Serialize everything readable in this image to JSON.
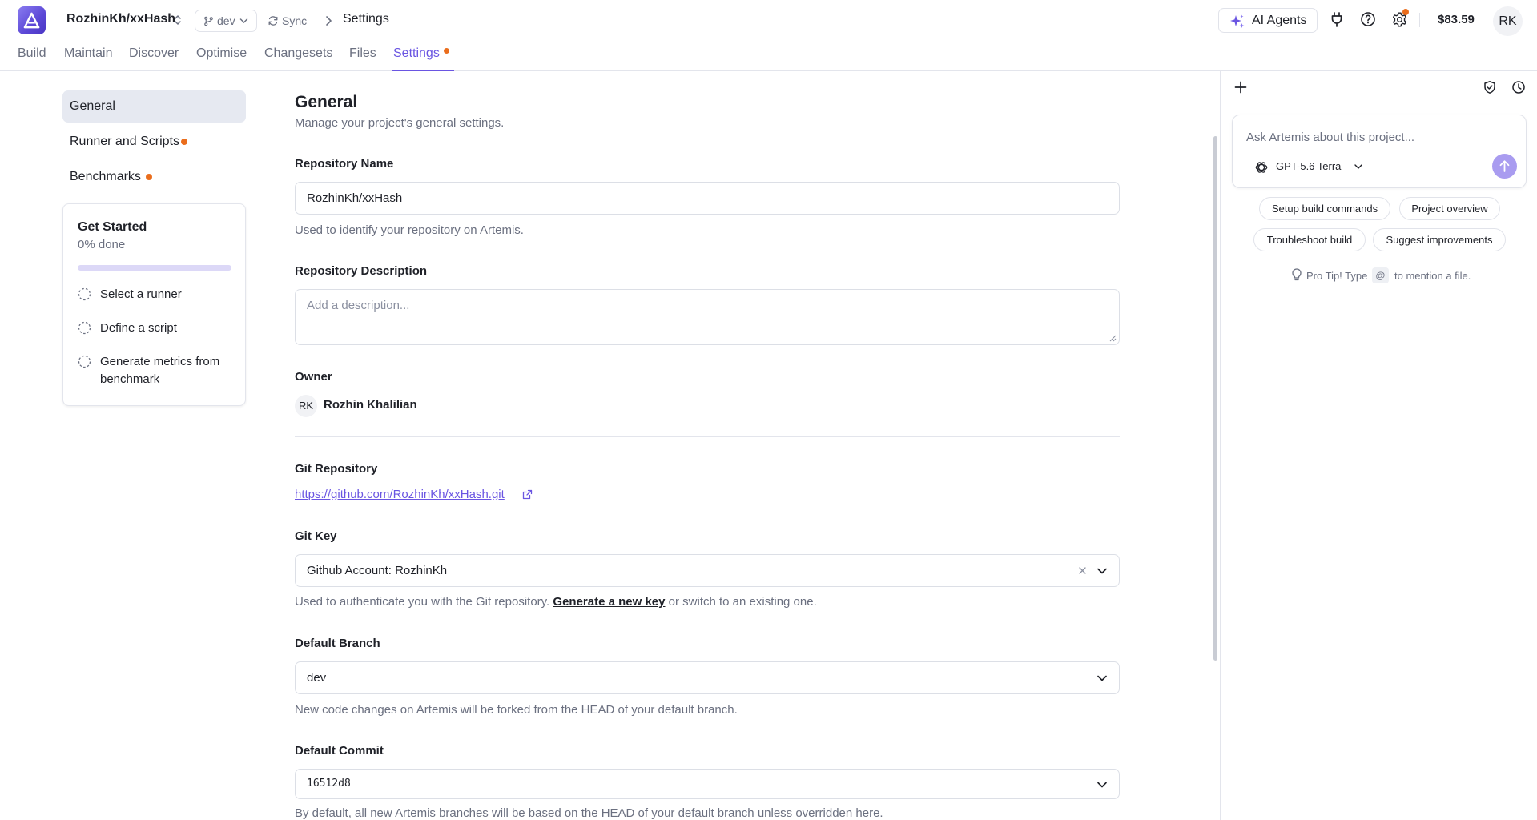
{
  "header": {
    "repo_name": "RozhinKh/xxHash",
    "branch": "dev",
    "sync_label": "Sync",
    "breadcrumb_current": "Settings",
    "ai_agents_label": "AI Agents",
    "balance": "$83.59",
    "user_initials": "RK"
  },
  "tabs": [
    {
      "label": "Build"
    },
    {
      "label": "Maintain"
    },
    {
      "label": "Discover"
    },
    {
      "label": "Optimise"
    },
    {
      "label": "Changesets"
    },
    {
      "label": "Files"
    },
    {
      "label": "Settings",
      "active": true,
      "has_dot": true
    }
  ],
  "sidebar": {
    "items": [
      {
        "label": "General",
        "active": true
      },
      {
        "label": "Runner and Scripts",
        "has_dot": true
      },
      {
        "label": "Benchmarks",
        "has_dot": true
      }
    ],
    "get_started": {
      "title": "Get Started",
      "progress_text": "0% done",
      "progress": 0,
      "steps": [
        {
          "label": "Select a runner"
        },
        {
          "label": "Define a script"
        },
        {
          "label": "Generate metrics from benchmark"
        }
      ]
    }
  },
  "main": {
    "title": "General",
    "subtitle": "Manage your project's general settings.",
    "repo_name_label": "Repository Name",
    "repo_name_value": "RozhinKh/xxHash",
    "repo_name_help": "Used to identify your repository on Artemis.",
    "repo_desc_label": "Repository Description",
    "repo_desc_placeholder": "Add a description...",
    "owner_label": "Owner",
    "owner_initials": "RK",
    "owner_name": "Rozhin Khalilian",
    "git_repo_label": "Git Repository",
    "git_repo_url": "https://github.com/RozhinKh/xxHash.git",
    "git_key_label": "Git Key",
    "git_key_value": "Github Account: RozhinKh",
    "git_key_help_before": "Used to authenticate you with the Git repository.",
    "git_key_help_link": "Generate a new key",
    "git_key_help_after": "or switch to an existing one.",
    "default_branch_label": "Default Branch",
    "default_branch_value": "dev",
    "default_branch_help": "New code changes on Artemis will be forked from the HEAD of your default branch.",
    "default_commit_label": "Default Commit",
    "default_commit_value": "16512d8",
    "default_commit_help": "By default, all new Artemis branches will be based on the HEAD of your default branch unless overridden here."
  },
  "assistant": {
    "placeholder": "Ask Artemis about this project...",
    "model": "GPT-5.6 Terra",
    "suggestions": [
      {
        "label": "Setup build commands"
      },
      {
        "label": "Project overview"
      },
      {
        "label": "Troubleshoot build"
      },
      {
        "label": "Suggest improvements"
      }
    ],
    "protip_before": "Pro Tip! Type",
    "protip_key": "@",
    "protip_after": "to mention a file."
  },
  "colors": {
    "accent": "#6a55e2",
    "dot": "#ea6d1c",
    "muted_text": "#6b7080"
  },
  "icons": [
    "logo-icon",
    "chevron-updown-icon",
    "git-branch-icon",
    "sync-icon",
    "chevron-right-icon",
    "sparkle-icon",
    "plug-icon",
    "help-icon",
    "gear-icon",
    "plus-icon",
    "shield-check-icon",
    "clock-icon",
    "openai-icon",
    "arrow-up-icon",
    "lightbulb-icon",
    "external-link-icon",
    "clear-icon",
    "chevron-down-icon",
    "dashed-circle-icon"
  ]
}
